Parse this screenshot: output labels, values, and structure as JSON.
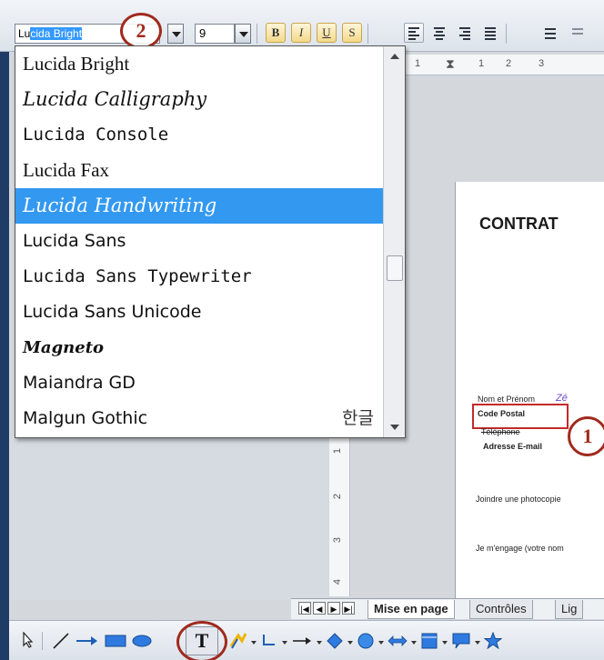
{
  "toolbar": {
    "font_name_value": "Lucida Bright",
    "font_name_highlight_prefix": "Lu",
    "font_name_highlight_sel": "cida Bright",
    "font_size_value": "9",
    "bold_label": "B",
    "italic_label": "I",
    "underline_label": "U",
    "shadow_label": "S"
  },
  "callouts": {
    "toolbar_marker": "2",
    "field_marker": "1"
  },
  "font_list": {
    "items": [
      {
        "label": "Lucida Bright",
        "selected": false
      },
      {
        "label": "Lucida Calligraphy",
        "selected": false
      },
      {
        "label": "Lucida Console",
        "selected": false
      },
      {
        "label": "Lucida Fax",
        "selected": false
      },
      {
        "label": "Lucida Handwriting",
        "selected": true
      },
      {
        "label": "Lucida Sans",
        "selected": false
      },
      {
        "label": "Lucida Sans Typewriter",
        "selected": false
      },
      {
        "label": "Lucida Sans Unicode",
        "selected": false
      },
      {
        "label": "Magneto",
        "selected": false
      },
      {
        "label": "Maiandra GD",
        "selected": false
      },
      {
        "label": "Malgun Gothic",
        "selected": false,
        "sample": "한글"
      }
    ]
  },
  "ruler": {
    "marks": [
      "1",
      "1",
      "1",
      "2",
      "3"
    ]
  },
  "vruler": {
    "marks": [
      "1",
      "2",
      "3",
      "4"
    ]
  },
  "document": {
    "title": "CONTRAT",
    "labels": {
      "name": "Nom et Prénom",
      "postal": "Code Postal",
      "phone": "Téléphone",
      "email": "Adresse E-mail"
    },
    "name_value_partial": "Zé",
    "text_join": "Joindre une photocopie",
    "text_commit": "Je m'engage (votre nom"
  },
  "sheet_tabs": [
    {
      "label": "Mise en page",
      "active": true
    },
    {
      "label": "Contrôles",
      "active": false
    },
    {
      "label": "Lig",
      "active": false
    }
  ],
  "colors": {
    "selection": "#3399f0",
    "callout_red": "#a02a1e",
    "field_box_red": "#c42a2a"
  }
}
